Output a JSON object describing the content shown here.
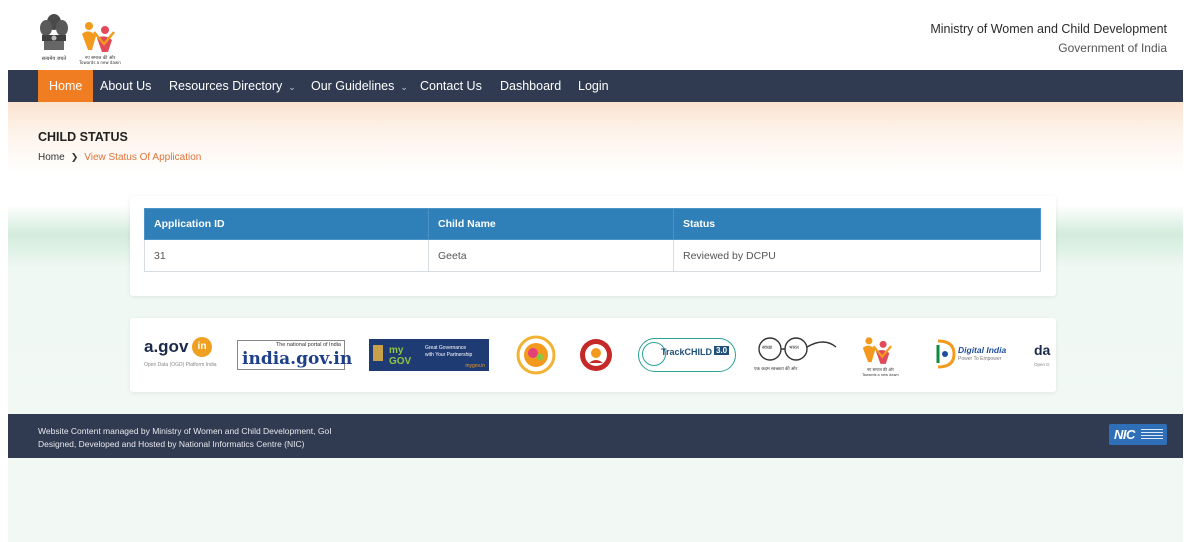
{
  "header": {
    "ministry": "Ministry of Women and Child Development",
    "government": "Government of India",
    "emblem_caption": "सत्यमेव जयते",
    "logo_caption_hindi": "नए समाज की ओर",
    "logo_caption_english": "Towards a new dawn"
  },
  "nav": {
    "items": [
      {
        "label": "Home",
        "active": true
      },
      {
        "label": "About Us"
      },
      {
        "label": "Resources Directory",
        "dropdown": true
      },
      {
        "label": "Our Guidelines",
        "dropdown": true
      },
      {
        "label": "Contact Us"
      },
      {
        "label": "Dashboard"
      },
      {
        "label": "Login"
      }
    ],
    "active_color": "#f17d22",
    "bg_color": "#303a50"
  },
  "page": {
    "title": "CHILD STATUS",
    "breadcrumb_home": "Home",
    "breadcrumb_current": "View Status Of Application"
  },
  "table": {
    "columns": [
      "Application ID",
      "Child Name",
      "Status"
    ],
    "rows": [
      [
        "31",
        "Geeta",
        "Reviewed by DCPU"
      ]
    ],
    "header_color": "#2f7fb9"
  },
  "logos": {
    "agov": "a.gov",
    "agov_in": "in",
    "agov_caption": "Open Data (OGD) Platform India",
    "indiagov_tag": "The national portal of India",
    "indiagov": "india.gov.in",
    "mygov_line1": "Great Governance",
    "mygov_line2": "with Your Partnership",
    "mygov_url": "mygov.in",
    "trackchild": "TrackCHILD",
    "trackchild_ver": "3.0",
    "swachh_left": "स्वच्छ",
    "swachh_right": "भारत",
    "swachh_caption": "एक कदम स्वच्छता की ओर",
    "wcd_caption1": "नए समाज की ओर",
    "wcd_caption2": "Towards a new dawn",
    "digital_india": "Digital India",
    "digital_india_tag": "Power To Empower",
    "data_partial": "da",
    "data_partial_caption": "Open D"
  },
  "footer": {
    "line1": "Website Content managed by Ministry of Women and Child Development, GoI",
    "line2": "Designed, Developed and Hosted by National Informatics Centre (NIC)",
    "nic": "NIC"
  }
}
